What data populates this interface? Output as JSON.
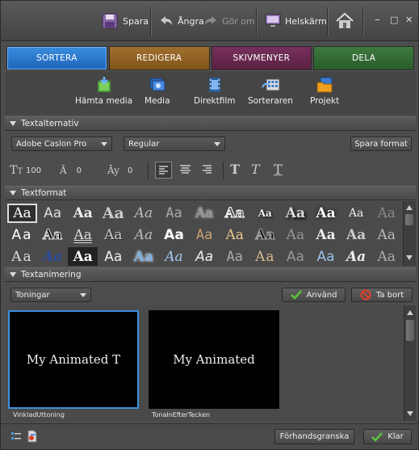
{
  "toolbar": {
    "save_label": "Spara",
    "undo_label": "Ångra",
    "redo_label": "Gör om",
    "fullscreen_label": "Helskärm",
    "home_icon": "home-icon",
    "window_min": "–",
    "window_max": "□",
    "window_close": "✕"
  },
  "tabs": [
    {
      "label": "SORTERA",
      "color": "#2a78d0",
      "active": true
    },
    {
      "label": "REDIGERA",
      "color": "#915f22",
      "active": false
    },
    {
      "label": "SKIVMENYER",
      "color": "#682750",
      "active": false
    },
    {
      "label": "DELA",
      "color": "#336b35",
      "active": false
    }
  ],
  "subtabs": [
    {
      "label": "Hämta media",
      "icon": "get-media-icon"
    },
    {
      "label": "Media",
      "icon": "media-icon"
    },
    {
      "label": "Direktfilm",
      "icon": "film-icon"
    },
    {
      "label": "Sorteraren",
      "icon": "organizer-icon"
    },
    {
      "label": "Projekt",
      "icon": "project-icon"
    }
  ],
  "text_options": {
    "header": "Textalternativ",
    "font": "Adobe Caslon Pro",
    "style": "Regular",
    "save_format": "Spara format",
    "size": "100",
    "leading": "0",
    "kerning": "0"
  },
  "text_format": {
    "header": "Textformat",
    "sample_text": "Aa",
    "row_counts": [
      13,
      13,
      13
    ]
  },
  "text_animation": {
    "header": "Textanimering",
    "filter": "Toningar",
    "apply": "Använd",
    "remove": "Ta bort",
    "items": [
      {
        "preview": "My Animated T",
        "caption": "VinkladUttoning",
        "selected": true
      },
      {
        "preview": "My Animated",
        "caption": "TonaInEfterTecken",
        "selected": false
      }
    ]
  },
  "footer": {
    "preview": "Förhandsgranska",
    "done": "Klar"
  },
  "colors": {
    "accent": "#2a78d0",
    "panel": "#4d4d4d",
    "ok_green": "#5cc33a",
    "remove_red": "#e0402a"
  }
}
